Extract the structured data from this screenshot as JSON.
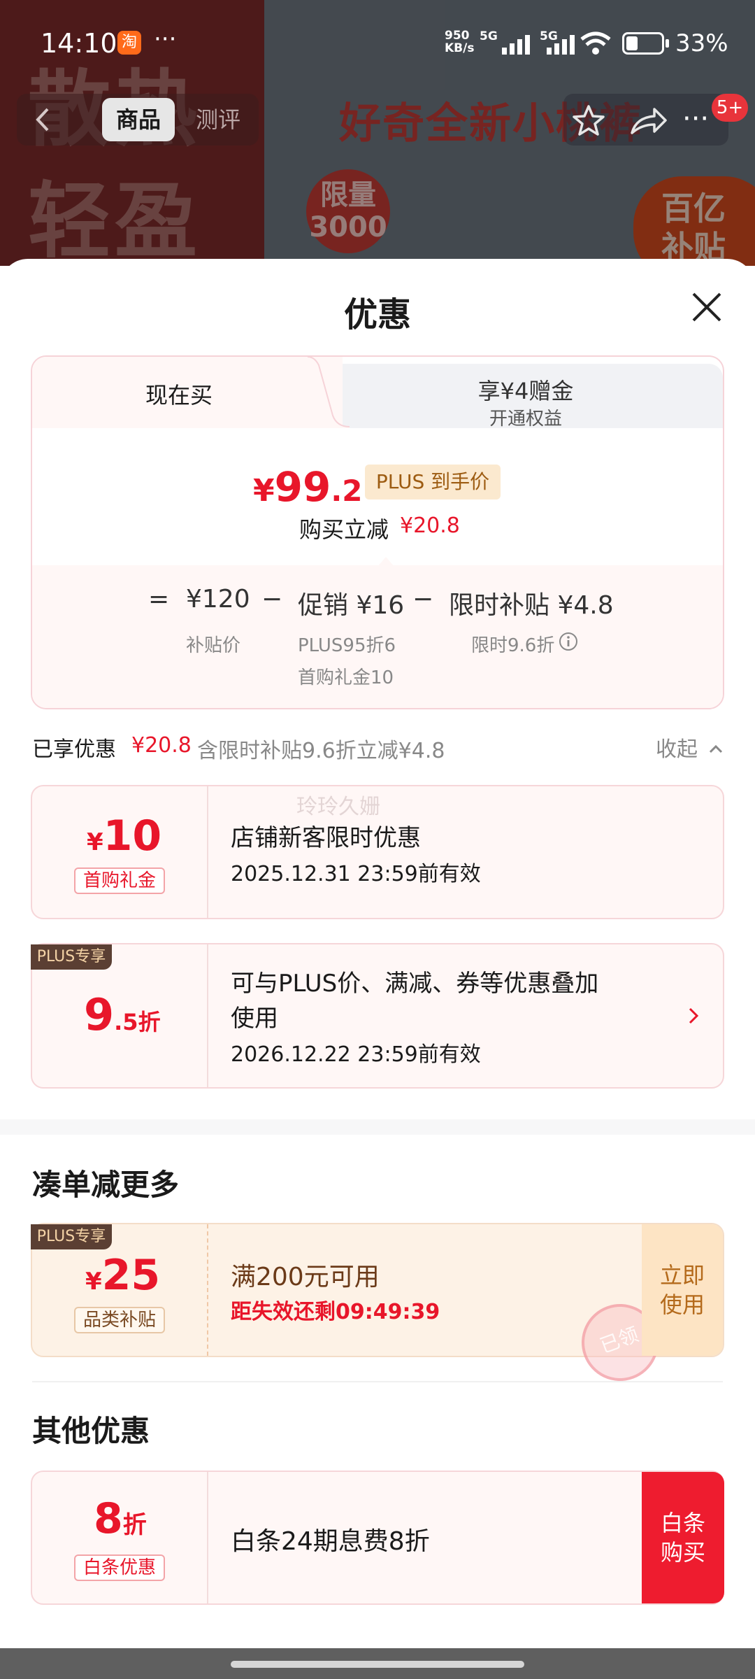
{
  "status_bar": {
    "time": "14:10",
    "app_icon_char": "淘",
    "dots": "···",
    "net_speed_top": "950",
    "net_speed_unit": "KB/s",
    "sim1": "5G",
    "sim2": "5G",
    "battery_percent_text": "33%",
    "battery_level": 0.33
  },
  "background": {
    "left_text_line1": "散热",
    "left_text_line2": "轻盈",
    "headline": "好奇全新小桃裤",
    "limit_badge_line1": "限量",
    "limit_badge_line2": "3000",
    "subsidy_badge_line1": "百亿",
    "subsidy_badge_line2": "补贴"
  },
  "nav": {
    "tab_product": "商品",
    "tab_review": "测评",
    "badge": "5+",
    "more": "···"
  },
  "sheet": {
    "title": "优惠"
  },
  "price_card": {
    "tab_buy_now": "现在买",
    "tab_gold": "享¥4赠金",
    "tab_gold_sub": "开通权益",
    "price_symbol": "¥",
    "price_int": "99",
    "price_dec": ".2",
    "plus_tag": "PLUS 到手价",
    "instant_label": "购买立减",
    "instant_value": "¥20.8",
    "breakdown": {
      "equals": "=",
      "base_price": "¥120",
      "base_label": "补贴价",
      "minus1": "−",
      "promo": "促销 ¥16",
      "promo_sub1": "PLUS95折6",
      "promo_sub2": "首购礼金10",
      "minus2": "−",
      "limited": "限时补贴 ¥4.8",
      "limited_sub": "限时9.6折"
    }
  },
  "enjoyed": {
    "label": "已享优惠",
    "amount": "¥20.8",
    "desc": "含限时补贴9.6折立减¥4.8",
    "collapse": "收起"
  },
  "watermark": "玲玲久姗",
  "coupons": [
    {
      "symbol": "¥",
      "value": "10",
      "tag": "首购礼金",
      "title": "店铺新客限时优惠",
      "date": "2025.12.31 23:59前有效"
    },
    {
      "plus_only": "PLUS专享",
      "value": "9",
      "value_suffix": ".5折",
      "title_line1": "可与PLUS价、满减、券等优惠叠加",
      "title_line2": "使用",
      "date": "2026.12.22 23:59前有效"
    }
  ],
  "more_section": {
    "title": "凑单减更多",
    "plus_only": "PLUS专享",
    "symbol": "¥",
    "value": "25",
    "tag": "品类补贴",
    "title_text": "满200元可用",
    "countdown": "距失效还剩09:49:39",
    "button_line1": "立即",
    "button_line2": "使用",
    "stamp": "已领"
  },
  "other_section": {
    "title": "其他优惠",
    "value": "8",
    "value_suffix": "折",
    "tag": "白条优惠",
    "title_text": "白条24期息费8折",
    "button_line1": "白条",
    "button_line2": "购买"
  },
  "colors": {
    "accent_red": "#e8162a",
    "plus_gold": "#9d5c12",
    "plus_brown": "#5b3f33"
  }
}
